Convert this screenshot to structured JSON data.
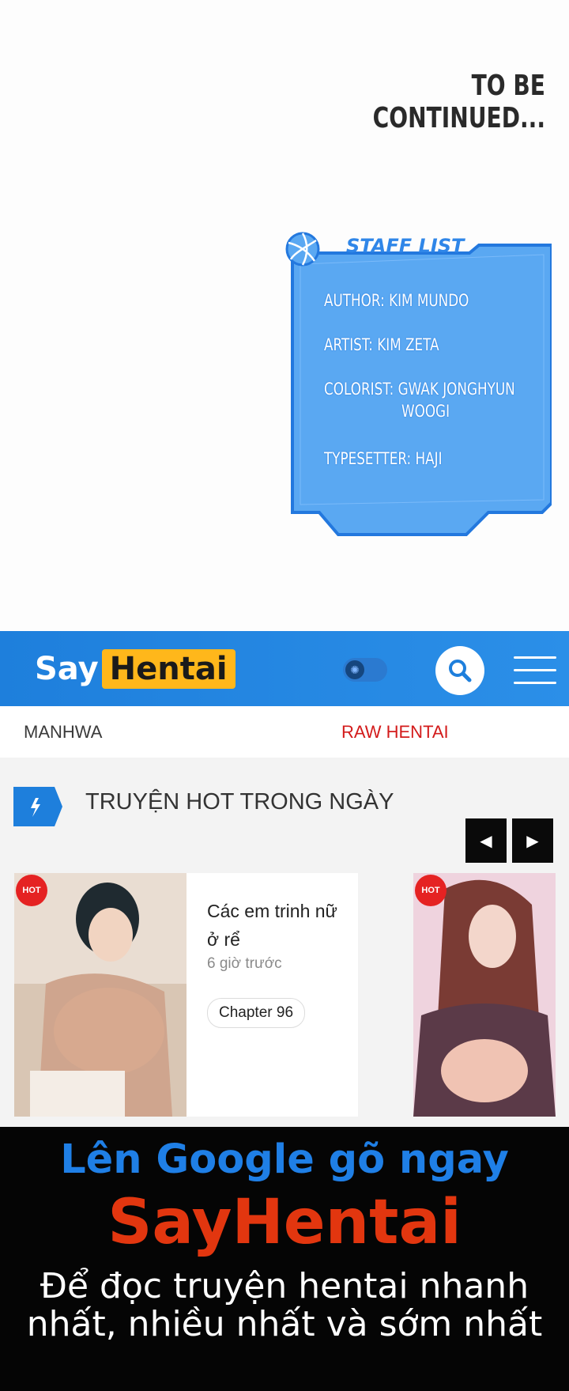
{
  "comic": {
    "to_be_continued": "TO BE CONTINUED...",
    "staff_title": "STAFF LIST",
    "staff": {
      "author": "AUTHOR: KIM MUNDO",
      "artist": "ARTIST: KIM ZETA",
      "colorist": "COLORIST: GWAK JONGHYUN",
      "colorist_2": "WOOGI",
      "typesetter": "TYPESETTER: HAJI"
    }
  },
  "header": {
    "logo_say": "Say",
    "logo_hentai": "Hentai",
    "theme_toggle": "off",
    "search_icon": "search-icon",
    "menu_icon": "hamburger-menu-icon",
    "brand_color": "#1e7fdc",
    "logo_accent": "#ffb71b"
  },
  "nav": {
    "items": [
      {
        "label": "MANHWA"
      },
      {
        "label": "RAW HENTAI"
      }
    ]
  },
  "hot_section": {
    "title": "TRUYỆN HOT TRONG NGÀY",
    "icon": "lightning-icon",
    "prev_icon": "caret-left-icon",
    "next_icon": "caret-right-icon",
    "cards": [
      {
        "badge": "HOT",
        "title": "Các em trinh nữ ở rể",
        "time": "6 giờ trước",
        "chapter": "Chapter 96"
      },
      {
        "badge": "HOT"
      }
    ]
  },
  "banner": {
    "line1": "Lên Google gõ ngay",
    "line2": "SayHentai",
    "line3": "Để đọc truyện hentai nhanh nhất, nhiều nhất và sớm nhất",
    "line1_color": "#1f7fe6",
    "line2_color": "#e2360f"
  }
}
